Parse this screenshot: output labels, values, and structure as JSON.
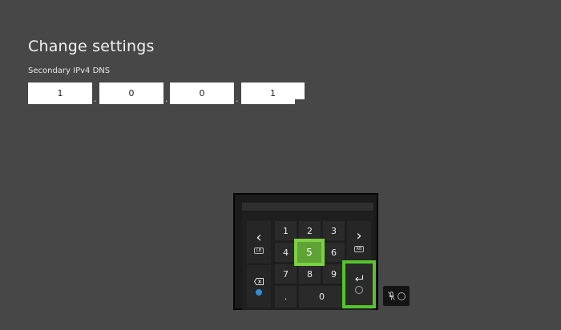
{
  "page": {
    "title": "Change settings",
    "field_label": "Secondary IPv4 DNS"
  },
  "ip_fields": [
    "1",
    "0",
    "0",
    "1"
  ],
  "ip_separator": ".",
  "keypad": {
    "keys": [
      "1",
      "2",
      "3",
      "4",
      "5",
      "6",
      "7",
      "8",
      "9",
      ".",
      "0"
    ],
    "focused_key": "5",
    "left_hint": "LB",
    "right_hint": "RB"
  },
  "colors": {
    "background": "#474747",
    "focus": "#6dbf3a",
    "keypad": "#1f1f1f"
  },
  "icons": [
    "chevron-left-icon",
    "chevron-right-icon",
    "backspace-icon",
    "x-button-icon",
    "enter-icon",
    "menu-button-icon",
    "mic-off-icon",
    "view-button-icon"
  ]
}
